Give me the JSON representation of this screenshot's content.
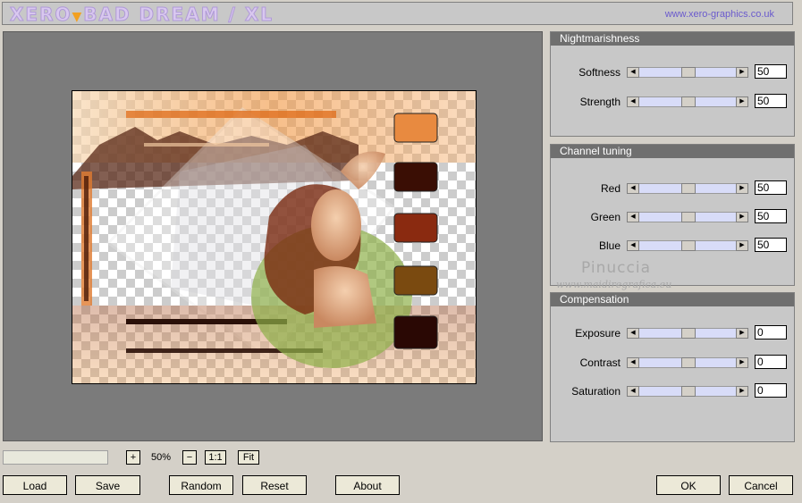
{
  "title": {
    "logo_left": "XERO",
    "logo_tri": "▼",
    "logo_right": "BAD DREAM / XL",
    "url": "www.xero-graphics.co.uk"
  },
  "panels": [
    {
      "title": "Nightmarishness",
      "controls": [
        {
          "label": "Softness",
          "value": "50"
        },
        {
          "label": "Strength",
          "value": "50"
        }
      ]
    },
    {
      "title": "Channel tuning",
      "controls": [
        {
          "label": "Red",
          "value": "50"
        },
        {
          "label": "Green",
          "value": "50"
        },
        {
          "label": "Blue",
          "value": "50"
        }
      ]
    },
    {
      "title": "Compensation",
      "controls": [
        {
          "label": "Exposure",
          "value": "0"
        },
        {
          "label": "Contrast",
          "value": "0"
        },
        {
          "label": "Saturation",
          "value": "0"
        }
      ]
    }
  ],
  "watermark": {
    "name": "Pinuccia",
    "site": "www.maidiregrafica.eu"
  },
  "zoom": {
    "plus": "+",
    "value": "50%",
    "minus": "−",
    "one_to_one": "1:1",
    "fit": "Fit"
  },
  "buttons": {
    "load": "Load",
    "save": "Save",
    "random": "Random",
    "reset": "Reset",
    "about": "About",
    "ok": "OK",
    "cancel": "Cancel"
  },
  "slider_positions": {
    "Softness": 0.5,
    "Strength": 0.5,
    "Red": 0.5,
    "Green": 0.5,
    "Blue": 0.5,
    "Exposure": 0.5,
    "Contrast": 0.5,
    "Saturation": 0.5
  },
  "colors": {
    "panel_header": "#6f6f6f",
    "slider_track": "#d8dcf8",
    "logo_fill": "#d9c8ef",
    "logo_accent": "#f2a020",
    "url_color": "#6a5acd"
  }
}
